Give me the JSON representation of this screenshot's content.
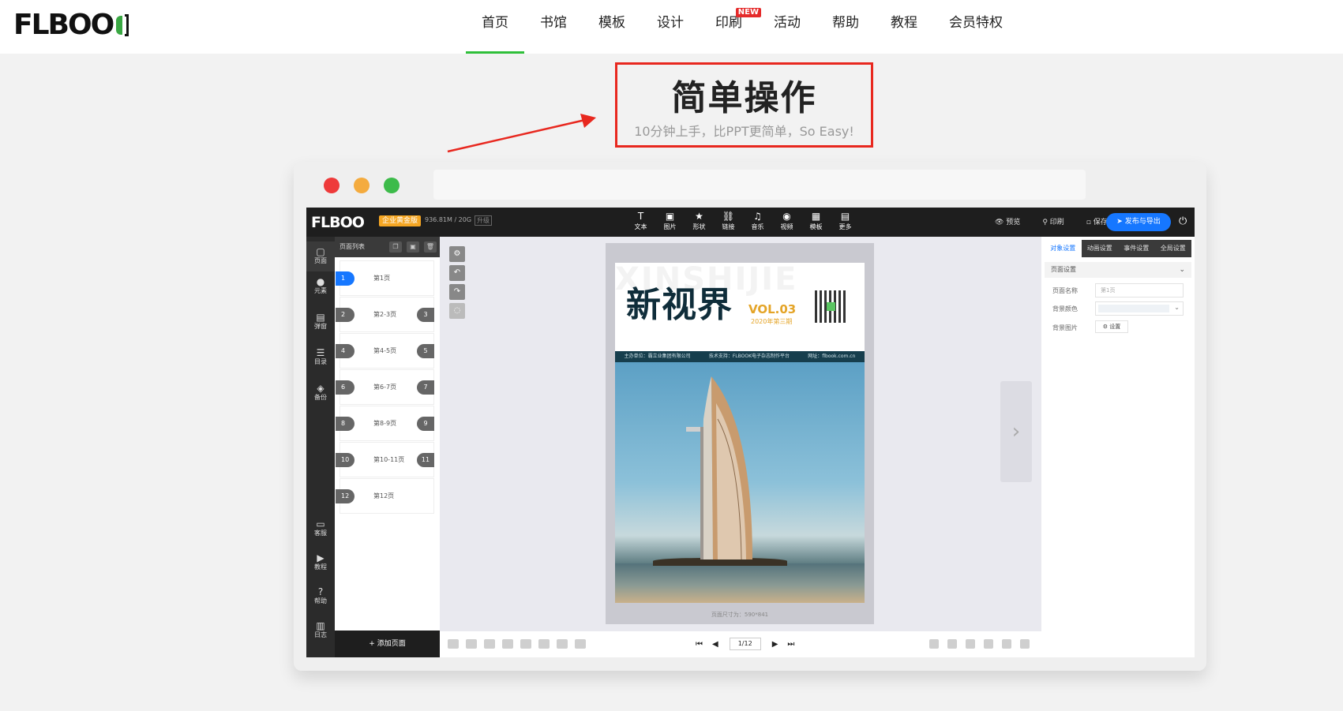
{
  "site": {
    "logo": "FLBOO",
    "nav": [
      {
        "label": "首页"
      },
      {
        "label": "书馆"
      },
      {
        "label": "模板"
      },
      {
        "label": "设计"
      },
      {
        "label": "印刷",
        "badge": "NEW"
      },
      {
        "label": "活动"
      },
      {
        "label": "帮助"
      },
      {
        "label": "教程"
      },
      {
        "label": "会员特权"
      }
    ],
    "active_nav": "首页",
    "accent": "#2fbf3a"
  },
  "hero": {
    "title": "简单操作",
    "subtitle": "10分钟上手，比PPT更简单，So Easy!",
    "highlight_color": "#e8281f"
  },
  "editor": {
    "logo": "FLBOO",
    "plan_badge": "企业黄金版",
    "storage": "936.81M / 20G",
    "upgrade": "升级",
    "tools": [
      {
        "icon": "T",
        "label": "文本"
      },
      {
        "icon": "▣",
        "label": "图片"
      },
      {
        "icon": "★",
        "label": "形状"
      },
      {
        "icon": "⛓",
        "label": "链接"
      },
      {
        "icon": "♫",
        "label": "音乐"
      },
      {
        "icon": "◉",
        "label": "视频"
      },
      {
        "icon": "▦",
        "label": "模板"
      },
      {
        "icon": "▤",
        "label": "更多"
      }
    ],
    "actions": {
      "preview": "预览",
      "print": "印刷",
      "save": "保存",
      "publish": "发布与导出"
    },
    "sidebar": [
      {
        "icon": "▢",
        "label": "页面"
      },
      {
        "icon": "●",
        "label": "元素"
      },
      {
        "icon": "▤",
        "label": "弹窗"
      },
      {
        "icon": "☰",
        "label": "目录"
      },
      {
        "icon": "◈",
        "label": "备份"
      },
      {
        "icon": "▭",
        "label": "客服"
      },
      {
        "icon": "▶",
        "label": "教程"
      },
      {
        "icon": "?",
        "label": "帮助"
      },
      {
        "icon": "▥",
        "label": "日志"
      }
    ],
    "page_list": {
      "title": "页面列表",
      "add_label": "+ 添加页面",
      "pages": [
        {
          "left": "1",
          "label": "第1页",
          "right": ""
        },
        {
          "left": "2",
          "label": "第2-3页",
          "right": "3"
        },
        {
          "left": "4",
          "label": "第4-5页",
          "right": "5"
        },
        {
          "left": "6",
          "label": "第6-7页",
          "right": "7"
        },
        {
          "left": "8",
          "label": "第8-9页",
          "right": "9"
        },
        {
          "left": "10",
          "label": "第10-11页",
          "right": "11"
        },
        {
          "left": "12",
          "label": "第12页",
          "right": ""
        }
      ]
    },
    "magazine": {
      "bg_text": "XINSHIJIE",
      "title": "新视界",
      "vol": "VOL.03",
      "issue": "2020年第三期",
      "band": [
        "主办单位：霸立业集团有限公司",
        "技术支持：FLBOOK电子杂志制作平台",
        "网址：flbook.com.cn"
      ],
      "page_size": "页面尺寸为：590*841"
    },
    "pager": {
      "current": "1/12"
    },
    "props": {
      "tabs": [
        "对象设置",
        "动画设置",
        "事件设置",
        "全局设置"
      ],
      "section": "页面设置",
      "page_name_label": "页面名称",
      "page_name_placeholder": "第1页",
      "bg_color_label": "背景颜色",
      "bg_image_label": "背景图片",
      "bg_image_button": "⚙ 设置"
    }
  }
}
